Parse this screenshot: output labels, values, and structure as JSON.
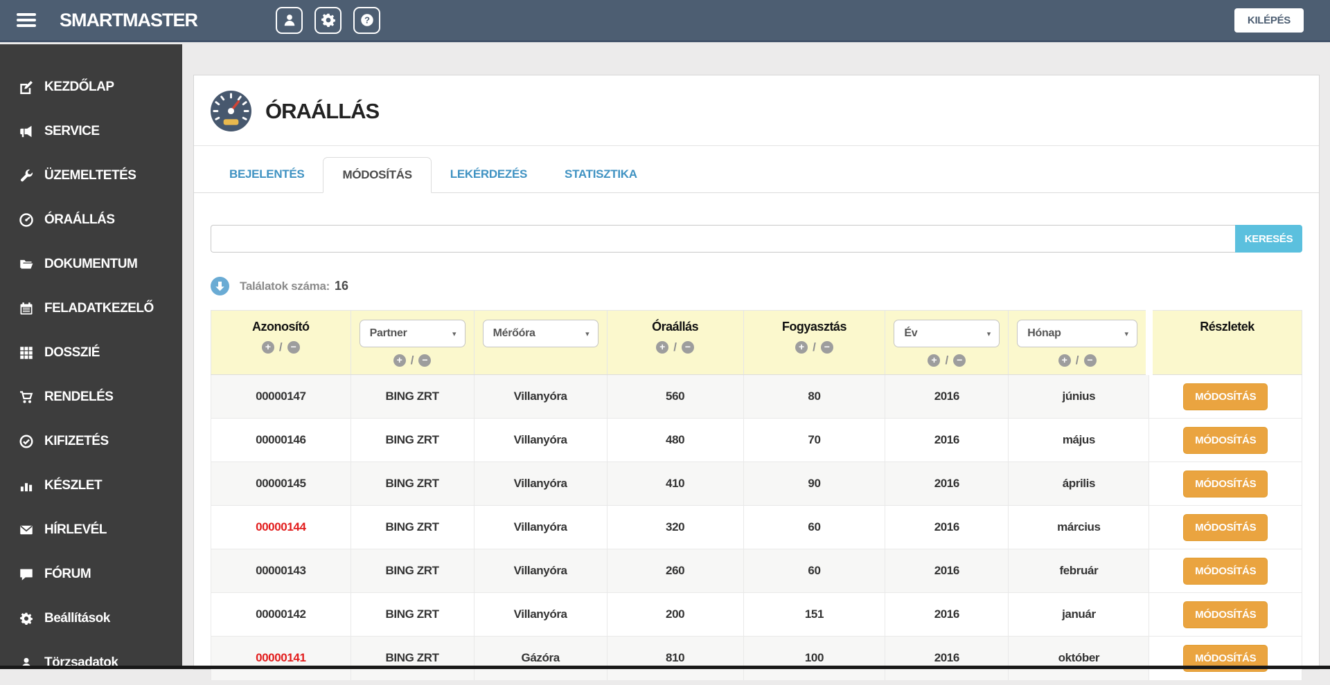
{
  "topbar": {
    "brand": "SMARTMASTER",
    "logout_label": "KILÉPÉS"
  },
  "sidebar": {
    "items": [
      {
        "label": "KEZDŐLAP",
        "icon": "edit"
      },
      {
        "label": "SERVICE",
        "icon": "bullhorn"
      },
      {
        "label": "ÜZEMELTETÉS",
        "icon": "wrench"
      },
      {
        "label": "ÓRAÁLLÁS",
        "icon": "gauge"
      },
      {
        "label": "DOKUMENTUM",
        "icon": "folder-open"
      },
      {
        "label": "FELADATKEZELŐ",
        "icon": "calendar"
      },
      {
        "label": "DOSSZIÉ",
        "icon": "grid"
      },
      {
        "label": "RENDELÉS",
        "icon": "shopping-cart"
      },
      {
        "label": "KIFIZETÉS",
        "icon": "check-circle"
      },
      {
        "label": "KÉSZLET",
        "icon": "bar-chart"
      },
      {
        "label": "HÍRLEVÉL",
        "icon": "envelope"
      },
      {
        "label": "FÓRUM",
        "icon": "comment"
      },
      {
        "label": "Beállítások",
        "icon": "gear"
      },
      {
        "label": "Törzsadatok",
        "icon": "user"
      }
    ]
  },
  "page": {
    "title": "ÓRAÁLLÁS",
    "tabs": [
      {
        "label": "BEJELENTÉS",
        "active": false
      },
      {
        "label": "MÓDOSÍTÁS",
        "active": true
      },
      {
        "label": "LEKÉRDEZÉS",
        "active": false
      },
      {
        "label": "STATISZTIKA",
        "active": false
      }
    ],
    "search": {
      "value": "",
      "button_label": "KERESÉS"
    },
    "results": {
      "label": "Találatok száma:",
      "count": "16"
    }
  },
  "table": {
    "columns": [
      {
        "label": "Azonosító",
        "type": "sortable"
      },
      {
        "label": "Partner",
        "type": "select-sortable"
      },
      {
        "label": "Mérőóra",
        "type": "select"
      },
      {
        "label": "Óraállás",
        "type": "sortable"
      },
      {
        "label": "Fogyasztás",
        "type": "sortable"
      },
      {
        "label": "Év",
        "type": "select-sortable"
      },
      {
        "label": "Hónap",
        "type": "select-sortable"
      },
      {
        "label": "Részletek",
        "type": "plain"
      }
    ],
    "action_label": "MÓDOSÍTÁS",
    "rows": [
      {
        "id": "00000147",
        "partner": "BING ZRT",
        "meter": "Villanyóra",
        "reading": "560",
        "consumption": "80",
        "year": "2016",
        "month": "június",
        "id_red": false
      },
      {
        "id": "00000146",
        "partner": "BING ZRT",
        "meter": "Villanyóra",
        "reading": "480",
        "consumption": "70",
        "year": "2016",
        "month": "május",
        "id_red": false
      },
      {
        "id": "00000145",
        "partner": "BING ZRT",
        "meter": "Villanyóra",
        "reading": "410",
        "consumption": "90",
        "year": "2016",
        "month": "április",
        "id_red": false
      },
      {
        "id": "00000144",
        "partner": "BING ZRT",
        "meter": "Villanyóra",
        "reading": "320",
        "consumption": "60",
        "year": "2016",
        "month": "március",
        "id_red": true
      },
      {
        "id": "00000143",
        "partner": "BING ZRT",
        "meter": "Villanyóra",
        "reading": "260",
        "consumption": "60",
        "year": "2016",
        "month": "február",
        "id_red": false
      },
      {
        "id": "00000142",
        "partner": "BING ZRT",
        "meter": "Villanyóra",
        "reading": "200",
        "consumption": "151",
        "year": "2016",
        "month": "január",
        "id_red": false
      },
      {
        "id": "00000141",
        "partner": "BING ZRT",
        "meter": "Gázóra",
        "reading": "810",
        "consumption": "100",
        "year": "2016",
        "month": "október",
        "id_red": true
      }
    ]
  },
  "icons": {
    "sort_asc": "+",
    "sort_desc": "−",
    "slash": "/",
    "caret": "▾",
    "question": "?"
  },
  "colors": {
    "topbar": "#4d5e72",
    "sidebar": "#3d3d3d",
    "tab_link": "#3f92c2",
    "search_button": "#5bc0de",
    "table_header_bg": "#fbf8cd",
    "action_button": "#eaa440",
    "red_id": "#e21d1d",
    "results_icon": "#6aabd4",
    "gauge_icon": "#47586e"
  }
}
